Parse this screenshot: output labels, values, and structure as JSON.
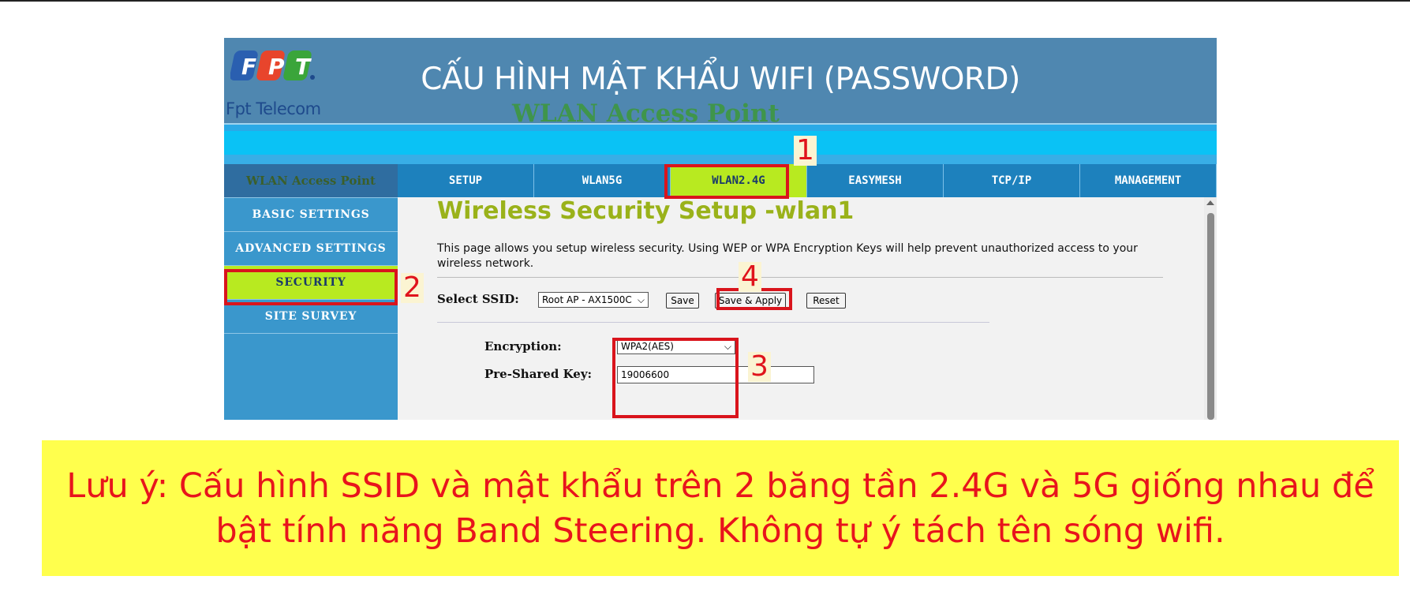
{
  "header": {
    "title": "CẤU HÌNH MẬT KHẨU WIFI (PASSWORD)",
    "logo_letters": "FPT",
    "logo_text": "Fpt Telecom",
    "ghost_title": "WLAN Access Point"
  },
  "sidebar": {
    "head": "WLAN Access Point",
    "items": [
      {
        "label": "BASIC SETTINGS"
      },
      {
        "label": "ADVANCED SETTINGS"
      },
      {
        "label": "SECURITY",
        "active": true
      },
      {
        "label": "SITE SURVEY"
      }
    ]
  },
  "tabs": [
    {
      "label": "SETUP"
    },
    {
      "label": "WLAN5G"
    },
    {
      "label": "WLAN2.4G",
      "active": true
    },
    {
      "label": "EASYMESH"
    },
    {
      "label": "TCP/IP"
    },
    {
      "label": "MANAGEMENT"
    }
  ],
  "content": {
    "page_title": "Wireless Security Setup -wlan1",
    "description": "This page allows you setup wireless security. Using WEP or WPA Encryption Keys will help prevent unauthorized access to your wireless network.",
    "ssid_label": "Select SSID:",
    "ssid_value": "Root AP - AX1500C",
    "save": "Save",
    "save_apply": "Save & Apply",
    "reset": "Reset",
    "encryption_label": "Encryption:",
    "encryption_value": "WPA2(AES)",
    "psk_label": "Pre-Shared Key:",
    "psk_value": "19006600"
  },
  "callouts": {
    "one": "1",
    "two": "2",
    "three": "3",
    "four": "4"
  },
  "note": {
    "line1": "Lưu ý: Cấu hình SSID và mật khẩu trên 2 băng tần 2.4G và 5G giống nhau để",
    "line2": "bật tính năng Band Steering. Không tự ý tách tên sóng wifi."
  },
  "colors": {
    "highlight": "#d9141c",
    "active_tab": "#b8ea20",
    "note_bg": "#ffff4d"
  }
}
